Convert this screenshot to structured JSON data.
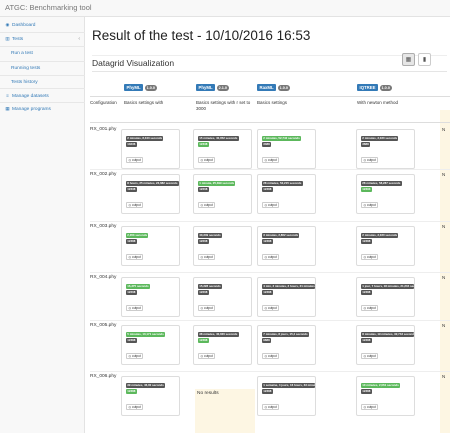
{
  "app": {
    "brand": "ATGC: Benchmarking tool"
  },
  "sidebar": {
    "items": [
      {
        "label": "Dashboard",
        "icon": "dashboard-icon"
      },
      {
        "label": "Tests",
        "icon": "chart-icon"
      },
      {
        "label": "Run a test"
      },
      {
        "label": "Running tests"
      },
      {
        "label": "Tests history"
      },
      {
        "label": "Manage datasets",
        "icon": "list-icon"
      },
      {
        "label": "Manage programs",
        "icon": "table-icon"
      }
    ]
  },
  "page": {
    "title": "Result of the test - 10/10/2016 16:53",
    "panel_title": "Datagrid Visualization"
  },
  "grid": {
    "config_header": "Configuration",
    "columns": [
      {
        "tool": "PhyML",
        "version": "1.0.0",
        "description": "Basics settings with"
      },
      {
        "tool": "PhyML",
        "version": "2.1.0",
        "description": "Basics settings with r set to 3000"
      },
      {
        "tool": "RaxML",
        "version": "1.0.0",
        "description": "Basics settings"
      },
      {
        "tool": "IQTREE",
        "version": "1.0.0",
        "description": "With newton method"
      }
    ],
    "output_label": "output",
    "no_results": "No results",
    "strip_letter": "N",
    "rows": [
      {
        "label": "RX_001.phy",
        "cells": [
          {
            "time": "2 minutes, 8,343 seconds",
            "time_color": "gray",
            "memory": "13236",
            "mem_color": "gray"
          },
          {
            "time": "15 minutes, 40,052 seconds",
            "time_color": "gray",
            "memory": "12338",
            "mem_color": "green"
          },
          {
            "time": "2 minutes, 52,742 seconds",
            "time_color": "green",
            "memory": "3388",
            "mem_color": "gray"
          },
          {
            "time": "2 minutes, 3,030 seconds",
            "time_color": "gray",
            "memory": "3888",
            "mem_color": "gray"
          }
        ]
      },
      {
        "label": "RX_002.phy",
        "cells": [
          {
            "time": "8 hours, 25 minutes, 23,682 seconds",
            "time_color": "gray",
            "memory": "12338",
            "mem_color": "gray"
          },
          {
            "time": "1 minute, 25,399 seconds",
            "time_color": "green",
            "memory": "12208",
            "mem_color": "gray"
          },
          {
            "time": "28 minutes, 52,215 seconds",
            "time_color": "gray",
            "memory": "12388",
            "mem_color": "gray"
          },
          {
            "time": "28 minutes, 58,287 seconds",
            "time_color": "gray",
            "memory": "12393",
            "mem_color": "green"
          }
        ]
      },
      {
        "label": "RX_003.phy",
        "cells": [
          {
            "time": "2,353 seconds",
            "time_color": "green",
            "memory": "12388",
            "mem_color": "gray"
          },
          {
            "time": "40,249 seconds",
            "time_color": "gray",
            "memory": "12208",
            "mem_color": "gray"
          },
          {
            "time": "3 minutes, 2,862 seconds",
            "time_color": "gray",
            "memory": "12388",
            "mem_color": "gray"
          },
          {
            "time": "2 minutes, 3,030 seconds",
            "time_color": "gray",
            "memory": "12388",
            "mem_color": "gray"
          }
        ]
      },
      {
        "label": "RX_004.phy",
        "cells": [
          {
            "time": "16,375 seconds",
            "time_color": "green",
            "memory": "12208",
            "mem_color": "gray"
          },
          {
            "time": "15,228 seconds",
            "time_color": "gray",
            "memory": "12208",
            "mem_color": "gray"
          },
          {
            "time": "4 min, 3 minutes, 3 hours, 21 minutes, 19,3 seconds",
            "time_color": "gray",
            "memory": "12388",
            "mem_color": "gray"
          },
          {
            "time": "1 jour, 7 hours, 18 minutes, 21,204 seconds",
            "time_color": "gray",
            "memory": "12388",
            "mem_color": "gray"
          }
        ]
      },
      {
        "label": "RX_005.phy",
        "cells": [
          {
            "time": "5 minutes, 10,171 seconds",
            "time_color": "green",
            "memory": "12388",
            "mem_color": "gray"
          },
          {
            "time": "38 minutes, 40,020 seconds",
            "time_color": "gray",
            "memory": "12388",
            "mem_color": "green"
          },
          {
            "time": "7 minutes, 8 jours, 15,4 seconds",
            "time_color": "gray",
            "memory": "9888",
            "mem_color": "gray"
          },
          {
            "time": "8 minutes, 19 minutes, 32,743 seconds",
            "time_color": "gray",
            "memory": "12388",
            "mem_color": "gray"
          }
        ]
      },
      {
        "label": "RX_006.phy",
        "cells": [
          {
            "time": "39 minutes, 46,00 seconds",
            "time_color": "gray",
            "memory": "12388",
            "mem_color": "green"
          },
          null,
          {
            "time": "1 semaine, 4 jours, 16 hours, 33 minutes, 7,01 seconds",
            "time_color": "gray",
            "memory": "12388",
            "mem_color": "gray"
          },
          {
            "time": "10 minutes, 2,061 seconds",
            "time_color": "green",
            "memory": "12388",
            "mem_color": "gray"
          }
        ]
      }
    ]
  }
}
